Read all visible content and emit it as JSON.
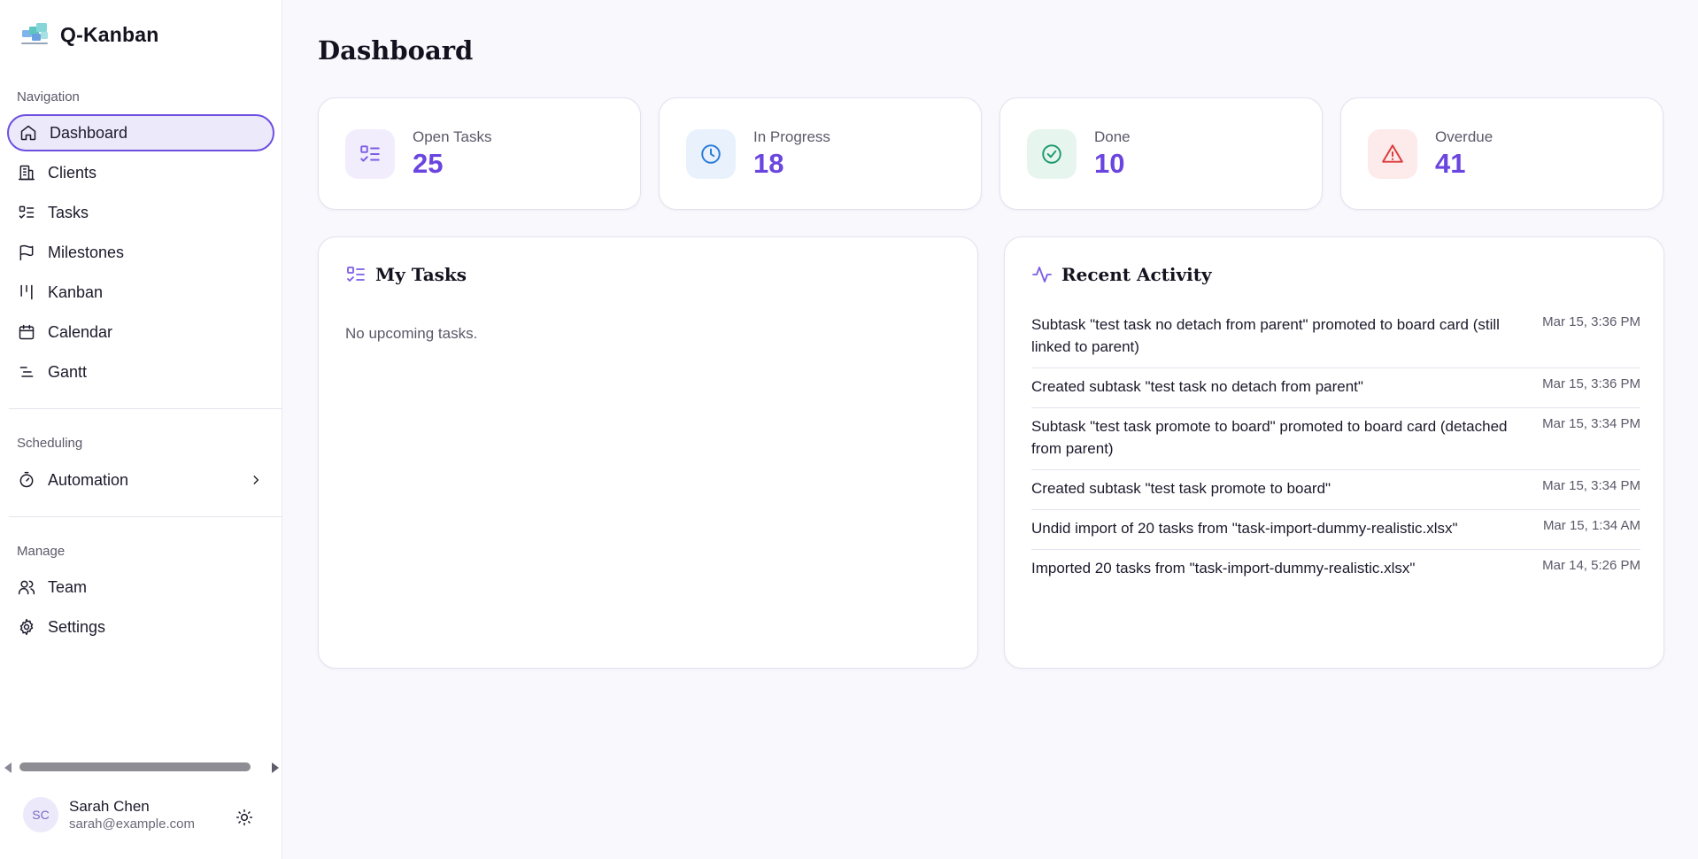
{
  "app": {
    "name": "Q-Kanban"
  },
  "sidebar": {
    "sections": {
      "navigation": "Navigation",
      "scheduling": "Scheduling",
      "manage": "Manage"
    },
    "nav_items": [
      {
        "label": "Dashboard",
        "icon": "home-icon",
        "active": true
      },
      {
        "label": "Clients",
        "icon": "building-icon"
      },
      {
        "label": "Tasks",
        "icon": "list-checks-icon"
      },
      {
        "label": "Milestones",
        "icon": "flag-icon"
      },
      {
        "label": "Kanban",
        "icon": "kanban-icon"
      },
      {
        "label": "Calendar",
        "icon": "calendar-icon"
      },
      {
        "label": "Gantt",
        "icon": "gantt-icon"
      }
    ],
    "scheduling_items": [
      {
        "label": "Automation",
        "icon": "timer-icon",
        "expandable": true
      }
    ],
    "manage_items": [
      {
        "label": "Team",
        "icon": "users-icon"
      },
      {
        "label": "Settings",
        "icon": "gear-icon"
      }
    ],
    "user": {
      "initials": "SC",
      "name": "Sarah Chen",
      "email": "sarah@example.com"
    }
  },
  "main": {
    "title": "Dashboard",
    "stats": [
      {
        "label": "Open Tasks",
        "value": "25",
        "icon": "list-checks-icon",
        "color": "#7c5ce6",
        "bg": "#f1edfd"
      },
      {
        "label": "In Progress",
        "value": "18",
        "icon": "clock-icon",
        "color": "#2b7bd9",
        "bg": "#e8f1fc"
      },
      {
        "label": "Done",
        "value": "10",
        "icon": "check-circle-icon",
        "color": "#1f9a6a",
        "bg": "#e6f6ef"
      },
      {
        "label": "Overdue",
        "value": "41",
        "icon": "alert-triangle-icon",
        "color": "#dc3a3a",
        "bg": "#fdeaea"
      }
    ],
    "my_tasks": {
      "title": "My Tasks",
      "empty": "No upcoming tasks."
    },
    "recent_activity": {
      "title": "Recent Activity",
      "items": [
        {
          "text": "Subtask \"test task no detach from parent\" promoted to board card (still linked to parent)",
          "time": "Mar 15, 3:36 PM"
        },
        {
          "text": "Created subtask \"test task no detach from parent\"",
          "time": "Mar 15, 3:36 PM"
        },
        {
          "text": "Subtask \"test task promote to board\" promoted to board card (detached from parent)",
          "time": "Mar 15, 3:34 PM"
        },
        {
          "text": "Created subtask \"test task promote to board\"",
          "time": "Mar 15, 3:34 PM"
        },
        {
          "text": "Undid import of 20 tasks from \"task-import-dummy-realistic.xlsx\"",
          "time": "Mar 15, 1:34 AM"
        },
        {
          "text": "Imported 20 tasks from \"task-import-dummy-realistic.xlsx\"",
          "time": "Mar 14, 5:26 PM"
        }
      ]
    }
  }
}
